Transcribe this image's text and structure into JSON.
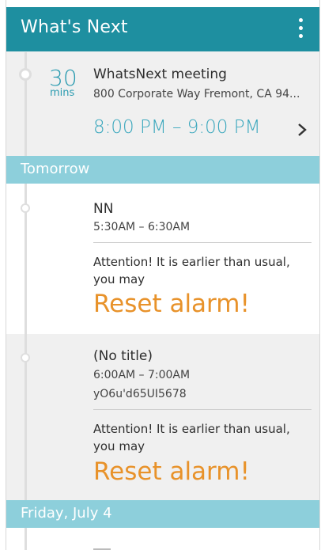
{
  "app_bar": {
    "title": "What's Next",
    "overflow_icon": "more-vert-icon"
  },
  "current_event": {
    "countdown_value": "30",
    "countdown_unit": "mins",
    "title": "WhatsNext meeting",
    "location": "800 Corporate Way Fremont, CA 94...",
    "time_range": "8:00 PM – 9:00 PM"
  },
  "sections": {
    "tomorrow": {
      "header": "Tomorrow",
      "events": [
        {
          "title": "NN",
          "time": "5:30AM – 6:30AM",
          "notice": "Attention! It is earlier than usual, you may",
          "action": "Reset alarm!"
        },
        {
          "title": "(No title)",
          "time": "6:00AM – 7:00AM",
          "location": "yO6u'd65UI5678",
          "notice": "Attention! It is earlier than usual, you may",
          "action": "Reset alarm!"
        }
      ]
    },
    "friday": {
      "header": "Friday, July 4"
    }
  },
  "colors": {
    "app_bar": "#1e8fa0",
    "section_header": "#8dcfdb",
    "accent_text": "#3aa7bd",
    "reset_action": "#e8922a"
  }
}
